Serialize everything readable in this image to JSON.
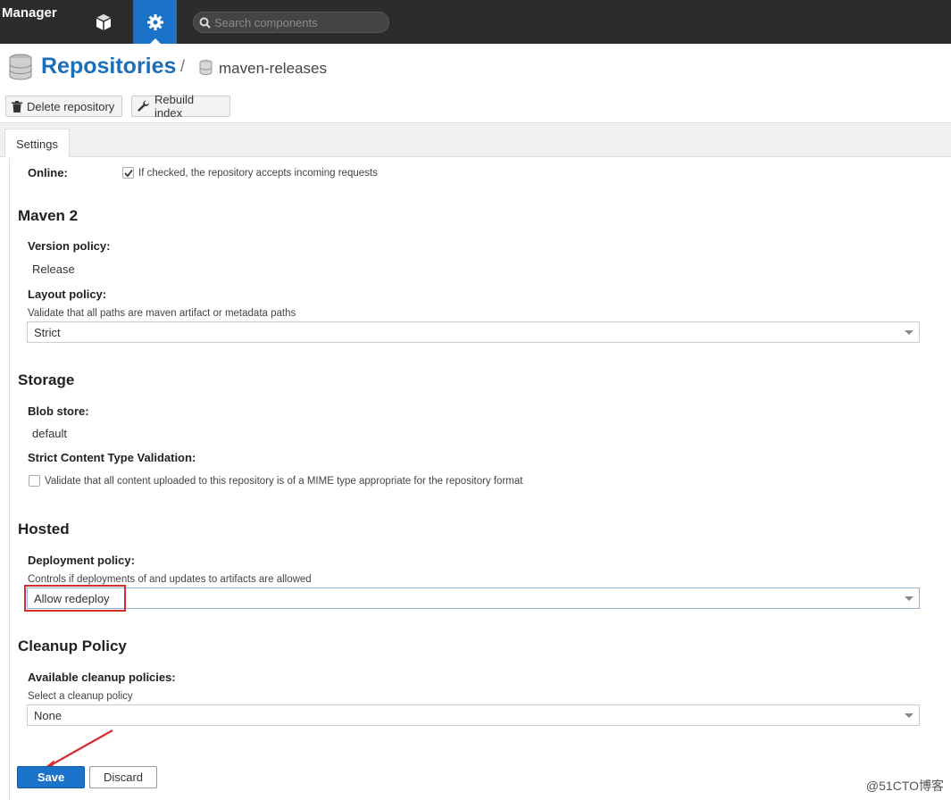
{
  "topbar": {
    "brand": "Manager",
    "search_placeholder": "Search components"
  },
  "header": {
    "title": "Repositories",
    "separator": "/",
    "subtitle": "maven-releases"
  },
  "toolbar": {
    "delete_label": "Delete repository",
    "rebuild_label": "Rebuild index"
  },
  "tabs": [
    {
      "label": "Settings"
    }
  ],
  "form": {
    "online": {
      "label": "Online:",
      "checked": true,
      "help": "If checked, the repository accepts incoming requests"
    },
    "maven": {
      "section_title": "Maven 2",
      "version_policy_label": "Version policy:",
      "version_policy_value": "Release",
      "layout_policy_label": "Layout policy:",
      "layout_policy_help": "Validate that all paths are maven artifact or metadata paths",
      "layout_policy_value": "Strict"
    },
    "storage": {
      "section_title": "Storage",
      "blob_store_label": "Blob store:",
      "blob_store_value": "default",
      "strict_label": "Strict Content Type Validation:",
      "strict_help": "Validate that all content uploaded to this repository is of a MIME type appropriate for the repository format",
      "strict_checked": false
    },
    "hosted": {
      "section_title": "Hosted",
      "deployment_label": "Deployment policy:",
      "deployment_help": "Controls if deployments of and updates to artifacts are allowed",
      "deployment_value": "Allow redeploy"
    },
    "cleanup": {
      "section_title": "Cleanup Policy",
      "available_label": "Available cleanup policies:",
      "available_help": "Select a cleanup policy",
      "available_value": "None"
    }
  },
  "actions": {
    "save_label": "Save",
    "discard_label": "Discard"
  },
  "watermark": "@51CTO博客",
  "colors": {
    "accent": "#1a73c8",
    "topbar": "#2c2c2c",
    "annotation": "#d62d2d"
  }
}
